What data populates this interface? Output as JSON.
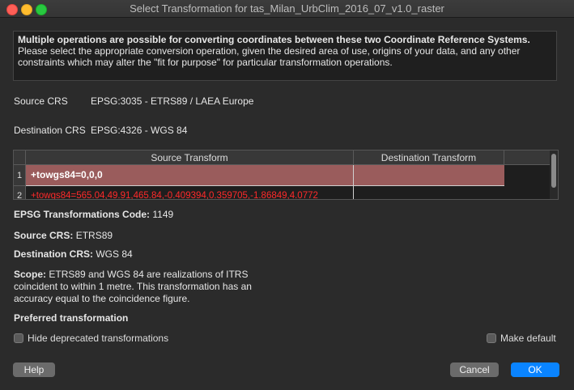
{
  "window": {
    "title": "Select Transformation for tas_Milan_UrbClim_2016_07_v1.0_raster"
  },
  "info": {
    "heading": "Multiple operations are possible for converting coordinates between these two Coordinate Reference Systems.",
    "body": "Please select the appropriate conversion operation, given the desired area of use, origins of your data, and any other constraints which may alter the \"fit for purpose\" for particular transformation operations."
  },
  "source_crs": {
    "label": "Source CRS",
    "value": "EPSG:3035 - ETRS89 / LAEA Europe"
  },
  "destination_crs": {
    "label": "Destination CRS",
    "value": "EPSG:4326 - WGS 84"
  },
  "table": {
    "columns": [
      "Source Transform",
      "Destination Transform"
    ],
    "rows": [
      {
        "num": "1",
        "source": "+towgs84=0,0,0",
        "destination": ""
      },
      {
        "num": "2",
        "source": "+towgs84=565.04,49.91,465.84,-0.409394,0.359705,-1.86849,4.0772",
        "destination": ""
      }
    ]
  },
  "details": {
    "code_label": "EPSG Transformations Code:",
    "code_value": "1149",
    "source_label": "Source CRS:",
    "source_value": "ETRS89",
    "dest_label": "Destination CRS:",
    "dest_value": "WGS 84",
    "scope_label": "Scope:",
    "scope_value": "ETRS89 and WGS 84 are realizations of ITRS coincident to within 1 metre. This transformation has an accuracy equal to the coincidence figure.",
    "preferred": "Preferred transformation"
  },
  "options": {
    "hide_deprecated": "Hide deprecated transformations",
    "make_default": "Make default"
  },
  "buttons": {
    "help": "Help",
    "cancel": "Cancel",
    "ok": "OK"
  },
  "colors": {
    "selected_row": "#9a5c5c",
    "error_text": "#ff2a2a",
    "accent": "#0a84ff"
  }
}
